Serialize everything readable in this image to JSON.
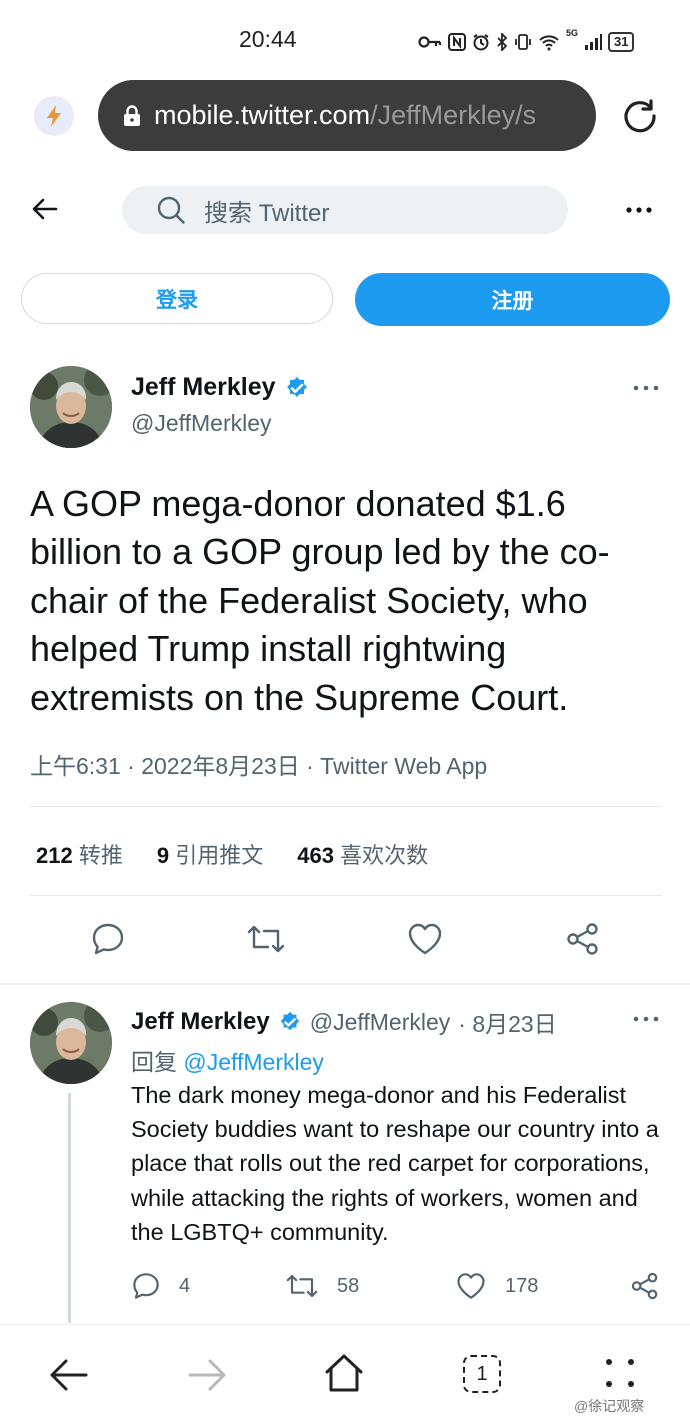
{
  "status_bar": {
    "time": "20:44",
    "network": "5G",
    "battery": "31",
    "icons": [
      "key-icon",
      "nfc-icon",
      "alarm-icon",
      "bluetooth-icon",
      "vibrate-icon",
      "wifi-icon",
      "signal-icon",
      "battery-icon"
    ]
  },
  "browser": {
    "url_domain": "mobile.twitter.com",
    "url_path": "/JeffMerkley/s"
  },
  "twitter": {
    "search_placeholder": "搜索 Twitter",
    "login_label": "登录",
    "signup_label": "注册",
    "accent_color": "#1d9bf0"
  },
  "main_tweet": {
    "name": "Jeff Merkley",
    "handle": "@JeffMerkley",
    "text": "A GOP mega-donor donated $1.6 billion to a GOP group led by the co-chair of the Federalist Society, who helped Trump install rightwing extremists on the Supreme Court.",
    "meta": "上午6:31 · 2022年8月23日 · Twitter Web App",
    "stats": {
      "retweets_count": "212",
      "retweets_label": "转推",
      "quotes_count": "9",
      "quotes_label": "引用推文",
      "likes_count": "463",
      "likes_label": "喜欢次数"
    }
  },
  "reply_tweet": {
    "name": "Jeff Merkley",
    "handle": "@JeffMerkley",
    "date": "· 8月23日",
    "reply_prefix": "回复",
    "reply_to": "@JeffMerkley",
    "text": "The dark money mega-donor and his Federalist Society buddies want to reshape our country into a place that rolls out the red carpet for corporations, while attacking the rights of workers, women and the LGBTQ+ community.",
    "replies": "4",
    "retweets": "58",
    "likes": "178"
  },
  "bottom_nav": {
    "tab_count": "1"
  },
  "watermark": "@徐记观察"
}
